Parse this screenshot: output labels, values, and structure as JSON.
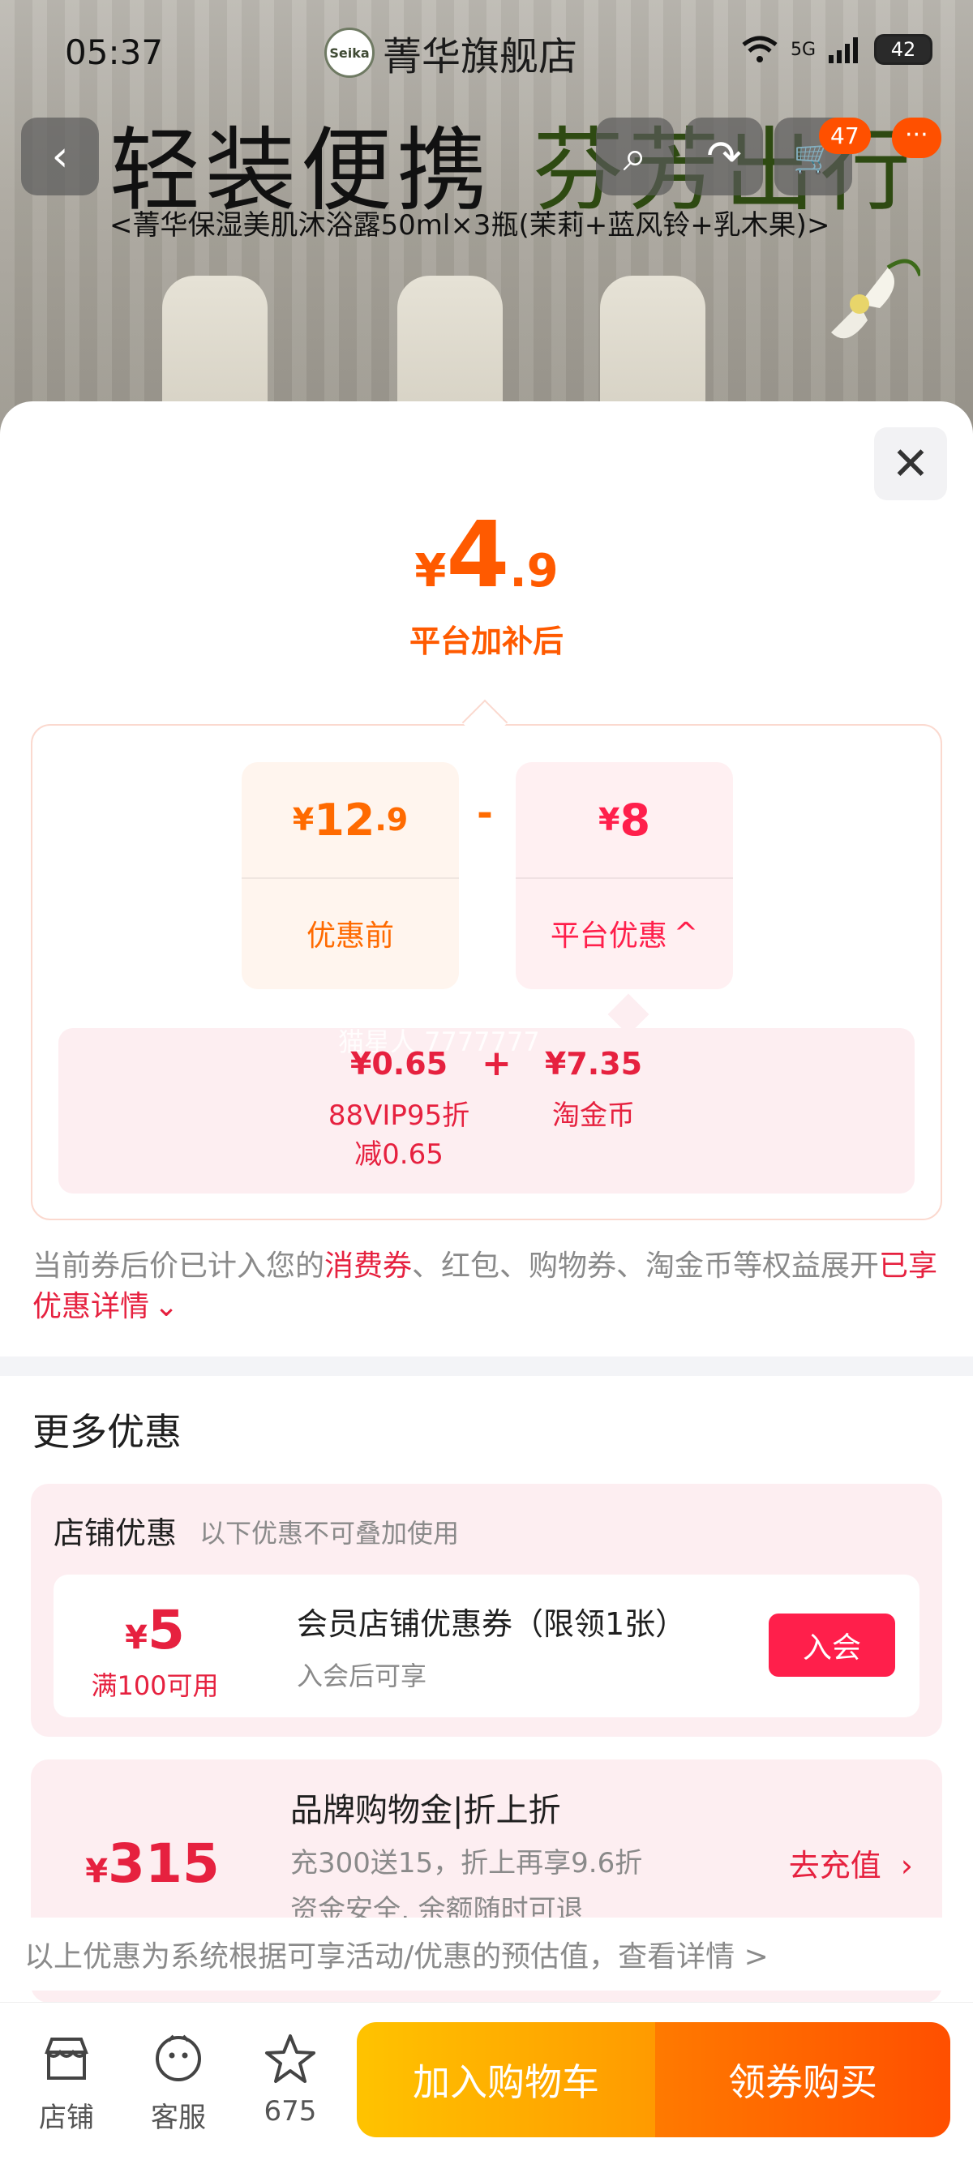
{
  "status_bar": {
    "time": "05:37",
    "network": "5G",
    "battery": "42"
  },
  "store": {
    "logo_text": "Seika",
    "name": "菁华旗舰店"
  },
  "hero": {
    "title_part1": "轻装便携",
    "title_part2": "芬芳出行",
    "subtitle": "<菁华保湿美肌沐浴露50ml×3瓶(茉莉+蓝风铃+乳木果)>"
  },
  "nav": {
    "back_icon": "‹",
    "search_icon": "⌕",
    "share_icon": "↷",
    "cart_icon": "🛒",
    "cart_badge": "47",
    "more_badge": "···"
  },
  "price_sheet": {
    "close_icon": "✕",
    "final": {
      "currency": "¥",
      "integer": "4",
      "decimal": ".9",
      "label": "平台加补后"
    },
    "before": {
      "currency": "¥",
      "integer": "12",
      "decimal": ".9",
      "label": "优惠前"
    },
    "operator": "-",
    "platform_discount": {
      "currency": "¥",
      "integer": "8",
      "label": "平台优惠",
      "chevron": "^"
    },
    "watermark": "猫星人 7777777",
    "details": [
      {
        "amount": "¥0.65",
        "line1": "88VIP95折",
        "line2": "减0.65"
      },
      {
        "amount": "¥7.35",
        "line1": "淘金币",
        "line2": ""
      }
    ],
    "plus": "+",
    "note": {
      "pre": "当前券后价已计入您的",
      "red1": "消费券",
      "mid": "、红包、购物券、淘金币等权益展开",
      "red2": "已享优惠详情",
      "chev": "⌄"
    }
  },
  "more_offers": {
    "title": "更多优惠",
    "shop": {
      "title": "店铺优惠",
      "subtitle": "以下优惠不可叠加使用",
      "coupon": {
        "currency": "¥",
        "amount": "5",
        "condition": "满100可用",
        "title": "会员店铺优惠券（限领1张）",
        "subtitle": "入会后可享",
        "button": "入会"
      }
    },
    "brand": {
      "currency": "¥",
      "amount": "315",
      "title": "品牌购物金|折上折",
      "line1": "充300送15，折上再享9.6折",
      "line2": "资金安全, 余额随时可退",
      "action": "去充值",
      "action_arrow": "›"
    }
  },
  "footer_note": "以上优惠为系统根据可享活动/优惠的预估值，查看详情 >",
  "bottom_bar": {
    "shop_label": "店铺",
    "service_label": "客服",
    "fav_count": "675",
    "cart_button": "加入购物车",
    "buy_button": "领券购买"
  },
  "colors": {
    "orange": "#ff5a00",
    "red": "#e6213f",
    "pink_bg": "#fdeef1"
  }
}
